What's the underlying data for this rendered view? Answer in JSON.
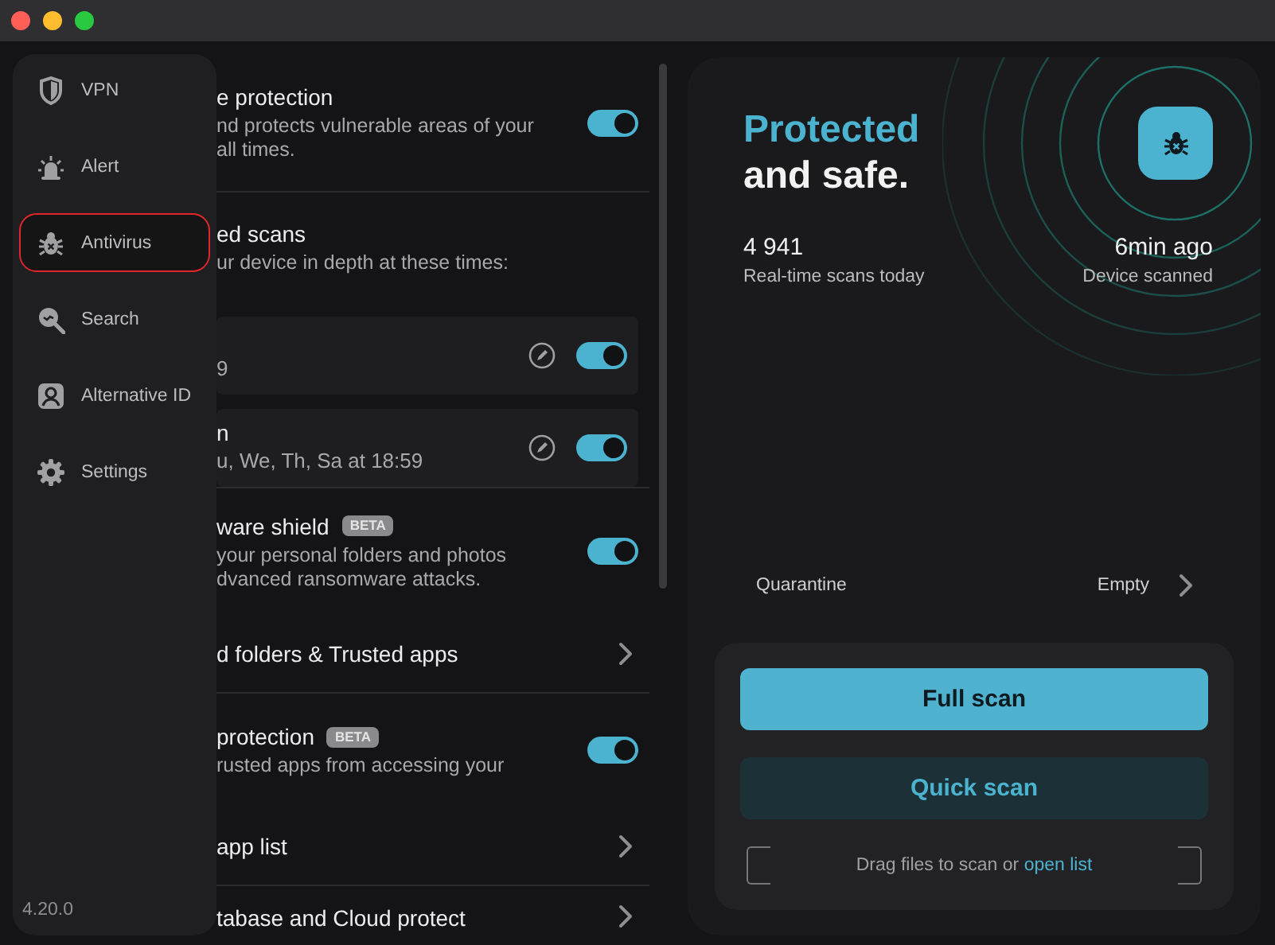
{
  "sidebar": {
    "items": [
      {
        "label": "VPN",
        "kind": "shield",
        "selected": false
      },
      {
        "label": "Alert",
        "kind": "siren",
        "selected": false
      },
      {
        "label": "Antivirus",
        "kind": "bug",
        "selected": true
      },
      {
        "label": "Search",
        "kind": "search",
        "selected": false
      },
      {
        "label": "Alternative ID",
        "kind": "person",
        "selected": false
      },
      {
        "label": "Settings",
        "kind": "gear",
        "selected": false
      }
    ],
    "version": "4.20.0"
  },
  "settings": [
    {
      "kind": "toggle",
      "title": "e protection",
      "description": "nd protects vulnerable areas of your\nall times.",
      "on": true,
      "divider": true
    },
    {
      "kind": "group",
      "title": "ed scans",
      "description": "ur device in depth at these times:",
      "divider": true,
      "schedules": [
        {
          "detail": "9",
          "on": true
        },
        {
          "title": "n",
          "detail": "u, We, Th, Sa at 18:59",
          "on": true
        }
      ]
    },
    {
      "kind": "toggle",
      "title": "ware shield",
      "badge": "BETA",
      "description": "your personal folders and photos\ndvanced ransomware attacks.",
      "on": true,
      "divider": false
    },
    {
      "kind": "link",
      "title": "d folders & Trusted apps",
      "divider": true
    },
    {
      "kind": "toggle",
      "title": "protection",
      "badge": "BETA",
      "description": "rusted apps from accessing your",
      "on": true,
      "divider": false
    },
    {
      "kind": "link",
      "title": "app list",
      "divider": true
    },
    {
      "kind": "link",
      "title": "tabase and Cloud protect"
    }
  ],
  "status": {
    "headline": "Protected",
    "subline": "and safe.",
    "scans_count": "4 941",
    "scans_label": "Real-time scans today",
    "last_scan": "6min ago",
    "last_scan_label": "Device scanned"
  },
  "quarantine": {
    "label": "Quarantine",
    "value": "Empty"
  },
  "actions": {
    "full_scan": "Full scan",
    "quick_scan": "Quick scan",
    "drop_hint": "Drag files to scan or ",
    "drop_link": "open list"
  }
}
